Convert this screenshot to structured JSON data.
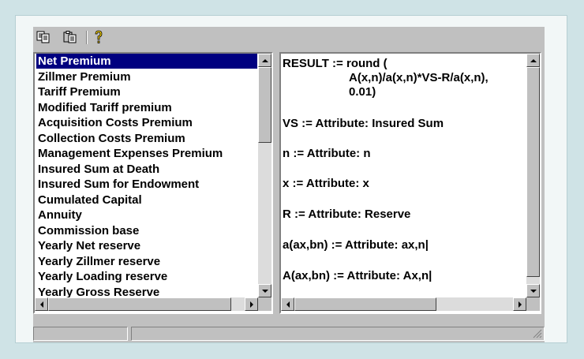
{
  "toolbar": {
    "icons": [
      "copy-icon",
      "paste-icon",
      "help-icon"
    ]
  },
  "premium_list": {
    "items": [
      "Net Premium",
      "Zillmer Premium",
      "Tariff Premium",
      "Modified Tariff premium",
      "Acquisition Costs Premium",
      "Collection Costs Premium",
      "Management Expenses Premium",
      "Insured Sum at Death",
      "Insured Sum for Endowment",
      "Cumulated Capital",
      "Annuity",
      "Commission base",
      "Yearly Net reserve",
      "Yearly Zillmer reserve",
      "Yearly Loading reserve",
      "Yearly Gross Reserve"
    ],
    "selected": "Net Premium"
  },
  "formula": {
    "lines": [
      "RESULT := round (",
      "A(x,n)/a(x,n)*VS-R/a(x,n),",
      "0.01)",
      "VS := Attribute: Insured Sum",
      "n := Attribute: n",
      "x := Attribute: x",
      "R := Attribute: Reserve",
      "a(ax,bn) := Attribute: ax,n|",
      "A(ax,bn) := Attribute: Ax,n|"
    ]
  },
  "colors": {
    "background": "#cfe3e6",
    "window": "#c0c0c0",
    "selection": "#000080"
  }
}
